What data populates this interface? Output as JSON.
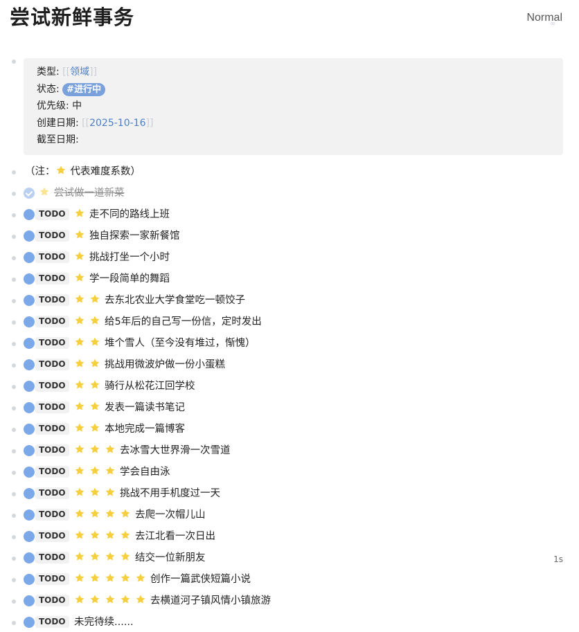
{
  "page": {
    "title": "尝试新鲜事务",
    "mode": "Normal"
  },
  "properties": {
    "type_label": "类型:",
    "type_open": "[[",
    "type_value": "领域",
    "type_close": "]]",
    "status_label": "状态:",
    "status_tag": "#进行中",
    "priority_label": "优先级:",
    "priority_value": "中",
    "created_label": "创建日期:",
    "created_open": "[[",
    "created_value": "2025-10-16",
    "created_close": "]]",
    "due_label": "截至日期:"
  },
  "note": {
    "prefix": "（注：",
    "suffix": "代表难度系数）"
  },
  "todo_label": "TODO",
  "timer": "1s",
  "colors": {
    "todo_circle": "#7aa8e8",
    "star": "#f5cf3d",
    "tag_bg": "#7aa1dc",
    "link": "#4a7fc7"
  },
  "tasks": [
    {
      "text": "尝试做一道新菜",
      "stars": 1,
      "done": true
    },
    {
      "text": "走不同的路线上班",
      "stars": 1,
      "done": false
    },
    {
      "text": "独自探索一家新餐馆",
      "stars": 1,
      "done": false
    },
    {
      "text": "挑战打坐一个小时",
      "stars": 1,
      "done": false
    },
    {
      "text": "学一段简单的舞蹈",
      "stars": 1,
      "done": false
    },
    {
      "text": "去东北农业大学食堂吃一顿饺子",
      "stars": 2,
      "done": false
    },
    {
      "text": "给5年后的自己写一份信，定时发出",
      "stars": 2,
      "done": false
    },
    {
      "text": "堆个雪人（至今没有堆过，惭愧）",
      "stars": 2,
      "done": false
    },
    {
      "text": "挑战用微波炉做一份小蛋糕",
      "stars": 2,
      "done": false
    },
    {
      "text": "骑行从松花江回学校",
      "stars": 2,
      "done": false
    },
    {
      "text": "发表一篇读书笔记",
      "stars": 2,
      "done": false
    },
    {
      "text": "本地完成一篇博客",
      "stars": 2,
      "done": false
    },
    {
      "text": "去冰雪大世界滑一次雪道",
      "stars": 3,
      "done": false
    },
    {
      "text": "学会自由泳",
      "stars": 3,
      "done": false
    },
    {
      "text": "挑战不用手机度过一天",
      "stars": 3,
      "done": false
    },
    {
      "text": "去爬一次帽儿山",
      "stars": 4,
      "done": false
    },
    {
      "text": "去江北看一次日出",
      "stars": 4,
      "done": false
    },
    {
      "text": "结交一位新朋友",
      "stars": 4,
      "done": false
    },
    {
      "text": "创作一篇武侠短篇小说",
      "stars": 5,
      "done": false
    },
    {
      "text": "去横道河子镇风情小镇旅游",
      "stars": 5,
      "done": false
    },
    {
      "text": "未完待续......",
      "stars": 0,
      "done": false
    }
  ]
}
